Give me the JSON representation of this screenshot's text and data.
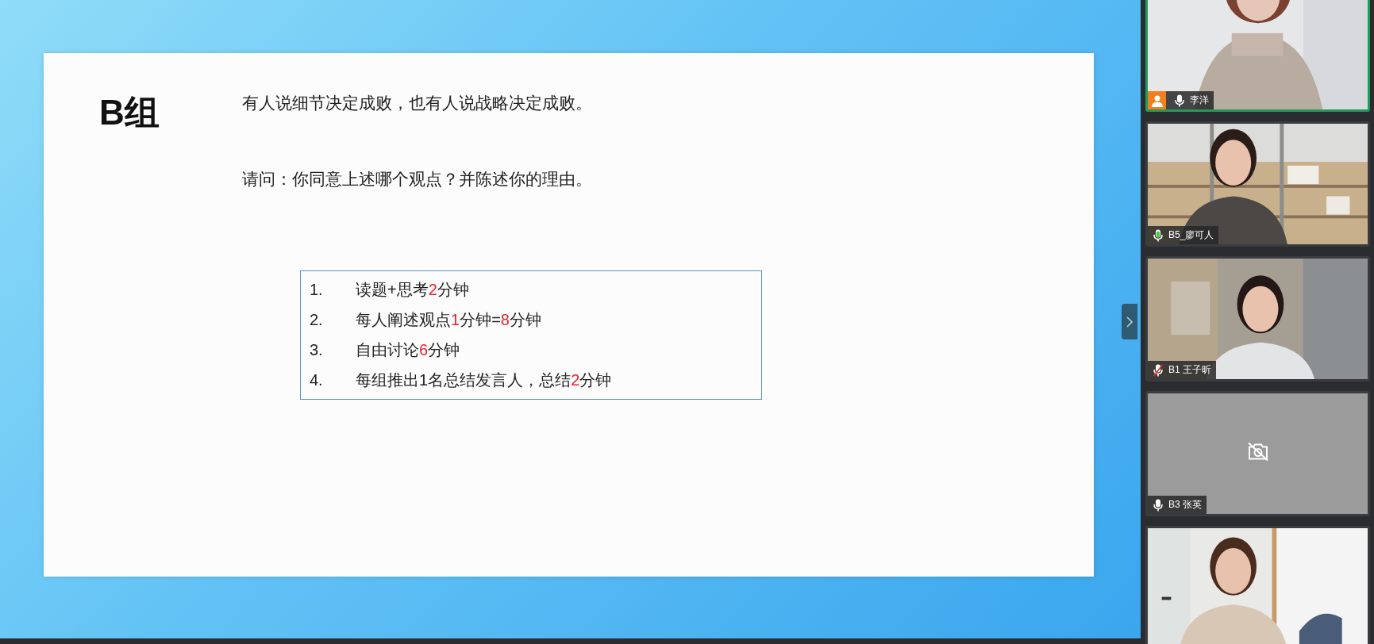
{
  "slide": {
    "group_title": "B组",
    "prompts": [
      "有人说细节决定成败，也有人说战略决定成败。",
      "请问：你同意上述哪个观点？并陈述你的理由。"
    ],
    "steps": [
      {
        "number": "1.",
        "segments": [
          {
            "text": "读题+思考",
            "highlight": false
          },
          {
            "text": "2",
            "highlight": true
          },
          {
            "text": "分钟",
            "highlight": false
          }
        ]
      },
      {
        "number": "2.",
        "segments": [
          {
            "text": "每人阐述观点",
            "highlight": false
          },
          {
            "text": "1",
            "highlight": true
          },
          {
            "text": "分钟=",
            "highlight": false
          },
          {
            "text": "8",
            "highlight": true
          },
          {
            "text": "分钟",
            "highlight": false
          }
        ]
      },
      {
        "number": "3.",
        "segments": [
          {
            "text": "自由讨论",
            "highlight": false
          },
          {
            "text": "6",
            "highlight": true
          },
          {
            "text": "分钟",
            "highlight": false
          }
        ]
      },
      {
        "number": "4.",
        "segments": [
          {
            "text": "每组推出1名总结发言人，总结",
            "highlight": false
          },
          {
            "text": "2",
            "highlight": true
          },
          {
            "text": "分钟",
            "highlight": false
          }
        ]
      }
    ]
  },
  "participants": [
    {
      "name": "李洋",
      "muted": false,
      "speaking": false,
      "host": true,
      "selected": true,
      "camera_off": false
    },
    {
      "name": "B5_廖可人",
      "muted": false,
      "speaking": true,
      "host": false,
      "selected": false,
      "camera_off": false
    },
    {
      "name": "B1 王子昕",
      "muted": true,
      "speaking": false,
      "host": false,
      "selected": false,
      "camera_off": false
    },
    {
      "name": "B3 张英",
      "muted": false,
      "speaking": false,
      "host": false,
      "selected": false,
      "camera_off": true
    },
    {
      "selected": false,
      "camera_off": false
    }
  ]
}
